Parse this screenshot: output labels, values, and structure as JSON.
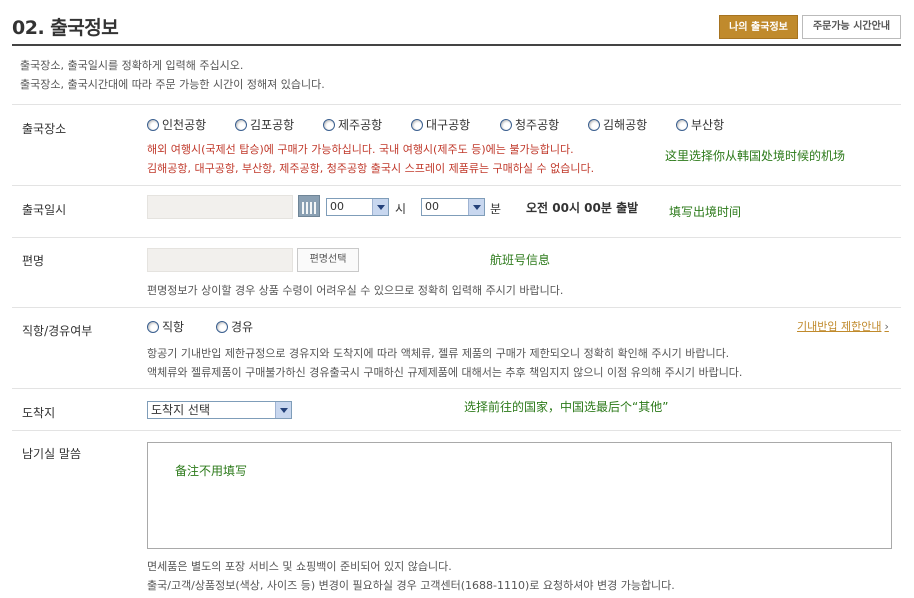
{
  "header": {
    "title": "02. 출국정보",
    "my_departure_btn": "나의 출국정보",
    "order_time_btn": "주문가능 시간안내"
  },
  "intro": {
    "line1": "출국장소, 출국일시를 정확하게 입력해 주십시오.",
    "line2": "출국장소, 출국시간대에 따라 주문 가능한 시간이 정해져 있습니다."
  },
  "departure_place": {
    "label": "출국장소",
    "options": [
      "인천공항",
      "김포공항",
      "제주공항",
      "대구공항",
      "청주공항",
      "김해공항",
      "부산항"
    ],
    "warning1": "해외 여행시(국제선 탑승)에 구매가 가능하십니다. 국내 여행시(제주도 등)에는 불가능합니다.",
    "warning2": "김해공항, 대구공항, 부산항, 제주공항, 청주공항 출국시 스프레이 제품류는 구매하실 수 없습니다.",
    "note": "这里选择你从韩国处境时候的机场"
  },
  "departure_datetime": {
    "label": "출국일시",
    "date_value": "",
    "hour_value": "00",
    "hour_unit": "시",
    "minute_value": "00",
    "minute_unit": "분",
    "summary": "오전 00시 00분 출발",
    "note": "填写出境时间"
  },
  "flight": {
    "label": "편명",
    "value": "",
    "select_btn": "편명선택",
    "note": "航班号信息",
    "help": "편명정보가 상이할 경우 상품 수령이 어려우실 수 있으므로 정확히 입력해 주시기 바랍니다."
  },
  "direct": {
    "label": "직항/경유여부",
    "options": [
      "직항",
      "경유"
    ],
    "link": "기내반입 제한안내",
    "help1": "항공기 기내반입 제한규정으로 경유지와 도착지에 따라 액체류, 젤류 제품의 구매가 제한되오니 정확히 확인해 주시기 바랍니다.",
    "help2": "액체류와 젤류제품이 구매불가하신 경유출국시 구매하신 규제제품에 대해서는 추후 책임지지 않으니 이점 유의해 주시기 바랍니다."
  },
  "destination": {
    "label": "도착지",
    "selected": "도착지 선택",
    "note": "选择前往的国家，中国选最后个“其他”"
  },
  "message": {
    "label": "남기실 말씀",
    "note": "备注不用填写",
    "help1": "면세품은 별도의 포장 서비스 및 쇼핑백이 준비되어 있지 않습니다.",
    "help2": "출국/고객/상품정보(색상, 사이즈 등) 변경이 필요하실 경우 고객센터(1688-1110)로 요청하셔야 변경 가능합니다."
  }
}
